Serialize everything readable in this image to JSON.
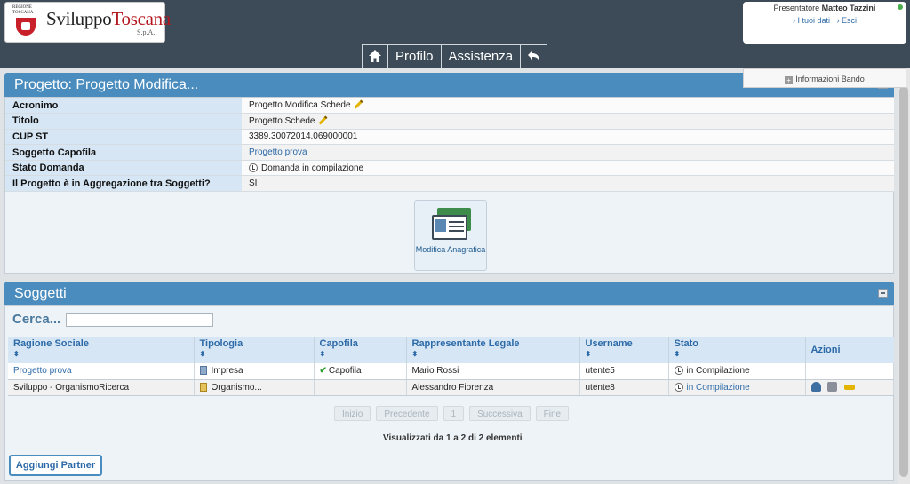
{
  "header": {
    "logo": {
      "region": "REGIONE TOSCANA",
      "name_part1": "Sviluppo",
      "name_part2": "Toscana",
      "suffix": "S.p.A."
    },
    "user": {
      "role_label": "Presentatore",
      "name": "Matteo Tazzini",
      "my_data_link": "› I tuoi dati",
      "logout_link": "› Esci"
    },
    "nav": {
      "home_icon": "home-icon",
      "profile": "Profilo",
      "assistance": "Assistenza",
      "back_icon": "back-arrow-icon"
    }
  },
  "info_bando": {
    "icon": "plus-icon",
    "label": "Informazioni Bando"
  },
  "project_panel": {
    "title": "Progetto: Progetto Modifica...",
    "rows": [
      {
        "label": "Acronimo",
        "value": "Progetto Modifica Schede"
      },
      {
        "label": "Titolo",
        "value": "Progetto Schede"
      },
      {
        "label": "CUP ST",
        "value": "3389.30072014.069000001"
      },
      {
        "label": "Soggetto Capofila",
        "value": "Progetto prova"
      },
      {
        "label": "Stato Domanda",
        "value": "Domanda in compilazione"
      },
      {
        "label": "Il Progetto è in Aggregazione tra Soggetti?",
        "value": "SI"
      }
    ],
    "edit_button": "Modifica Anagrafica"
  },
  "soggetti_panel": {
    "title": "Soggetti",
    "search_label": "Cerca...",
    "search_value": "",
    "columns": [
      "Ragione Sociale",
      "Tipologia",
      "Capofila",
      "Rappresentante Legale",
      "Username",
      "Stato",
      "Azioni"
    ],
    "rows": [
      {
        "ragione": "Progetto prova",
        "tipologia": "Impresa",
        "capofila": "Capofila",
        "rappresentante": "Mario Rossi",
        "username": "utente5",
        "stato": "in Compilazione"
      },
      {
        "ragione": "Sviluppo - OrganismoRicerca",
        "tipologia": "Organismo...",
        "capofila": "",
        "rappresentante": "Alessandro Fiorenza",
        "username": "utente8",
        "stato": "in Compilazione"
      }
    ],
    "pager": {
      "first": "Inizio",
      "prev": "Precedente",
      "page": "1",
      "next": "Successiva",
      "last": "Fine"
    },
    "pager_info": "Visualizzati da 1 a 2 di 2 elementi",
    "add_partner": "Aggiungi Partner"
  },
  "colors": {
    "accent": "#4a8cbe",
    "header_bg": "#3c4b57",
    "link": "#2d6aa8"
  }
}
